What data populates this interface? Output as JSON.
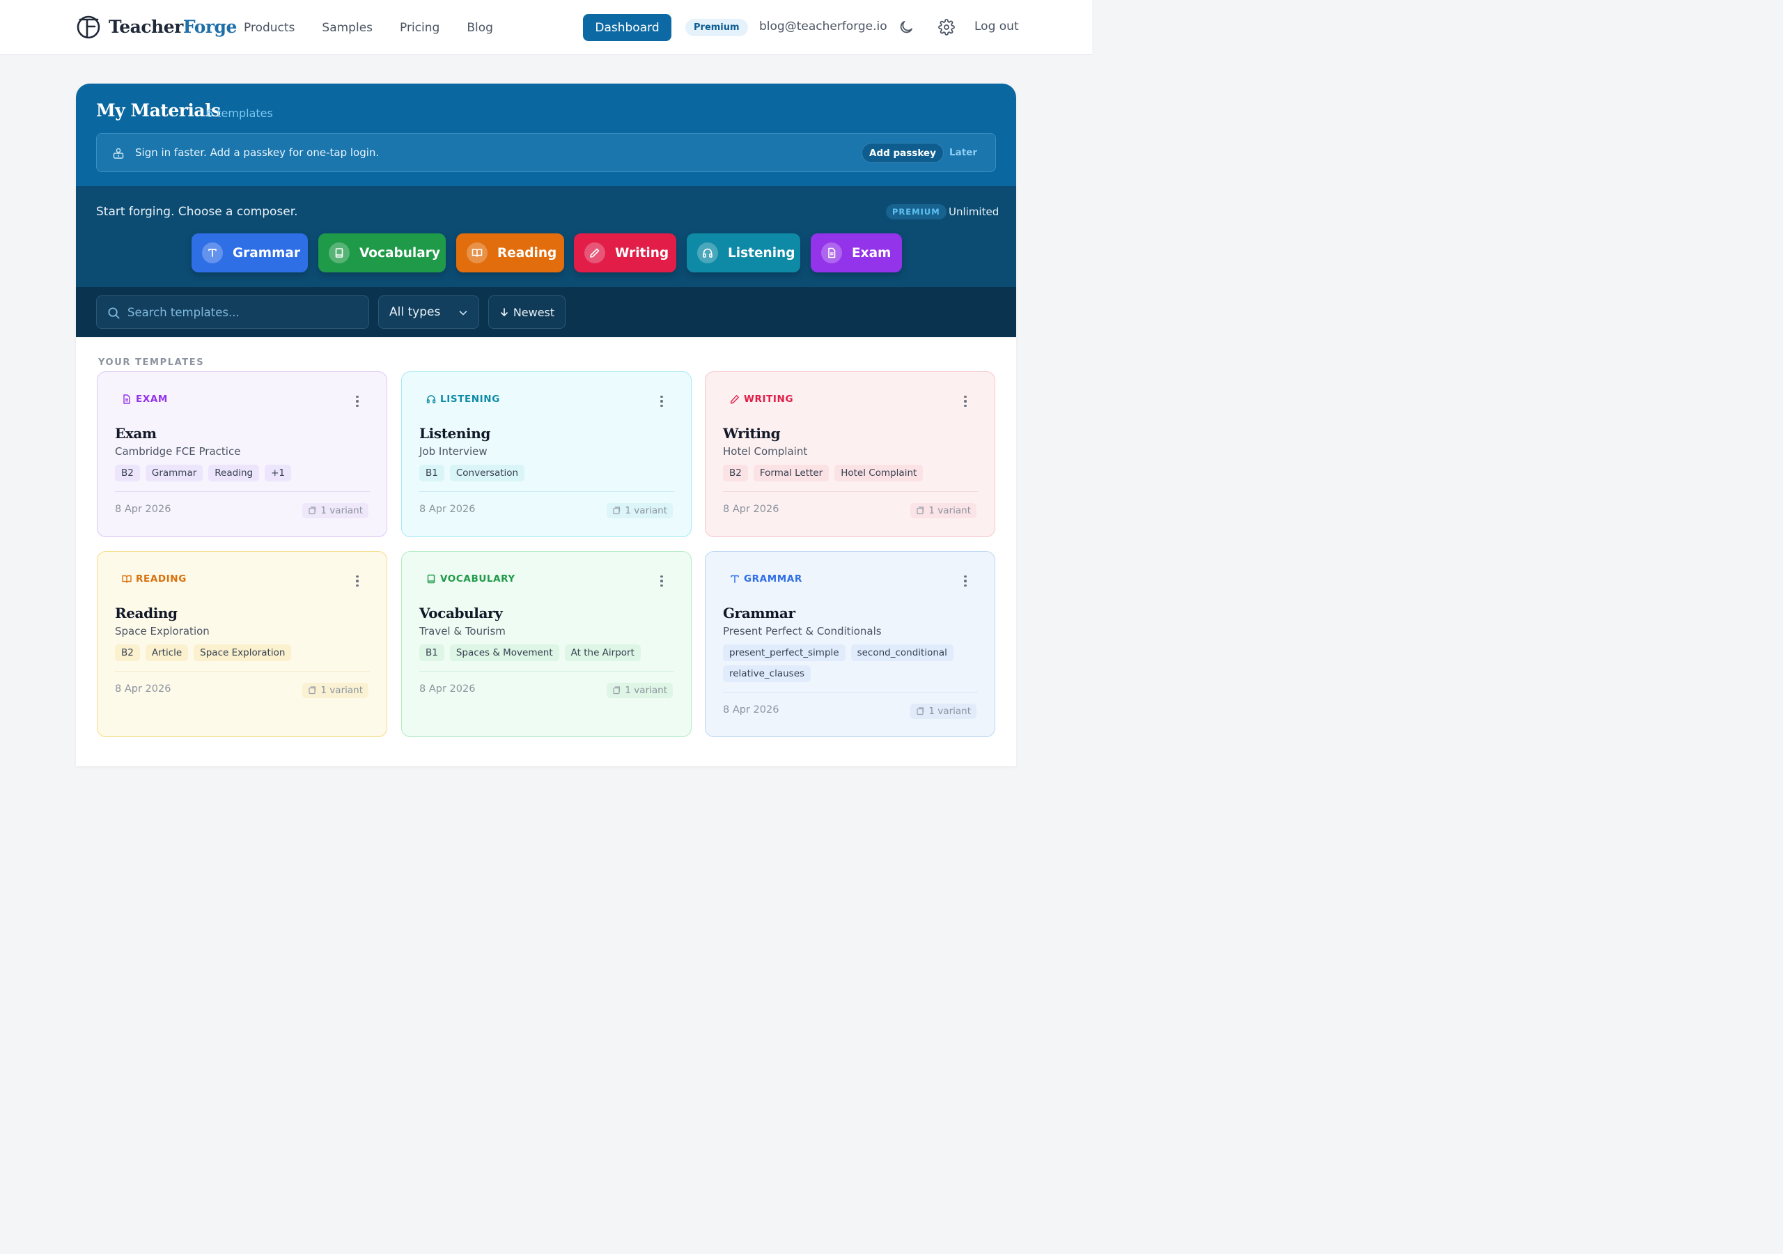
{
  "header": {
    "logo_part1": "Teacher",
    "logo_part2": "Forge",
    "nav": [
      "Products",
      "Samples",
      "Pricing",
      "Blog"
    ],
    "dashboard_label": "Dashboard",
    "plan_badge": "Premium",
    "email": "blog@teacherforge.io",
    "logout_label": "Log out"
  },
  "hero": {
    "title": "My Materials",
    "count": "6 templates",
    "passkey": {
      "message": "Sign in faster. Add a passkey for one-tap login.",
      "add_label": "Add passkey",
      "later_label": "Later"
    }
  },
  "composer": {
    "title": "Start forging. Choose a composer.",
    "plan_badge": "PREMIUM",
    "plan_quota": "Unlimited",
    "buttons": [
      {
        "label": "Grammar",
        "icon": "letter-t-icon",
        "color": "#2f6fe6"
      },
      {
        "label": "Vocabulary",
        "icon": "book-icon",
        "color": "#1f9a48"
      },
      {
        "label": "Reading",
        "icon": "open-book-icon",
        "color": "#e16d0c"
      },
      {
        "label": "Writing",
        "icon": "pencil-icon",
        "color": "#e11d48"
      },
      {
        "label": "Listening",
        "icon": "headphones-icon",
        "color": "#0e8aa6"
      },
      {
        "label": "Exam",
        "icon": "document-icon",
        "color": "#9333ea"
      }
    ]
  },
  "filters": {
    "search_placeholder": "Search templates...",
    "type_select": "All types",
    "sort_label": "Newest"
  },
  "templates": {
    "section_label": "YOUR TEMPLATES",
    "cards": [
      {
        "type": "EXAM",
        "title": "Exam",
        "subtitle": "Cambridge FCE Practice",
        "tags": [
          "B2",
          "Grammar",
          "Reading",
          "+1"
        ],
        "date": "8 Apr 2026",
        "variants": "1 variant",
        "accent": "#9333ea"
      },
      {
        "type": "LISTENING",
        "title": "Listening",
        "subtitle": "Job Interview",
        "tags": [
          "B1",
          "Conversation"
        ],
        "date": "8 Apr 2026",
        "variants": "1 variant",
        "accent": "#0e8aa6"
      },
      {
        "type": "WRITING",
        "title": "Writing",
        "subtitle": "Hotel Complaint",
        "tags": [
          "B2",
          "Formal Letter",
          "Hotel Complaint"
        ],
        "date": "8 Apr 2026",
        "variants": "1 variant",
        "accent": "#e11d48"
      },
      {
        "type": "READING",
        "title": "Reading",
        "subtitle": "Space Exploration",
        "tags": [
          "B2",
          "Article",
          "Space Exploration"
        ],
        "date": "8 Apr 2026",
        "variants": "1 variant",
        "accent": "#d9700c"
      },
      {
        "type": "VOCABULARY",
        "title": "Vocabulary",
        "subtitle": "Travel & Tourism",
        "tags": [
          "B1",
          "Spaces & Movement",
          "At the Airport"
        ],
        "date": "8 Apr 2026",
        "variants": "1 variant",
        "accent": "#1f9a48"
      },
      {
        "type": "GRAMMAR",
        "title": "Grammar",
        "subtitle": "Present Perfect & Conditionals",
        "tags": [
          "present_perfect_simple",
          "second_conditional",
          "relative_clauses"
        ],
        "date": "8 Apr 2026",
        "variants": "1 variant",
        "accent": "#2f6fe6"
      }
    ]
  }
}
